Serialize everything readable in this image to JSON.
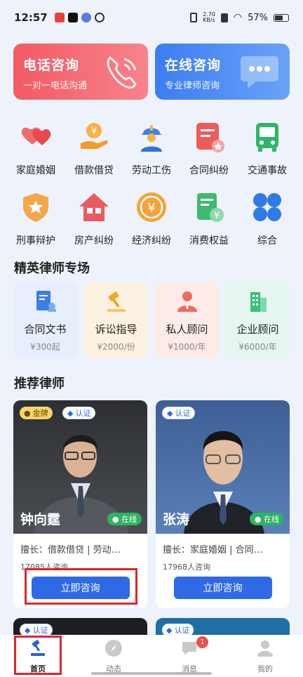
{
  "status_bar": {
    "time": "12:57",
    "net_speed_top": "2.70",
    "net_speed_bottom": "KB/s",
    "battery": "57%"
  },
  "banners": [
    {
      "title": "电话咨询",
      "subtitle": "一对一电话沟通",
      "color": "#f25a64"
    },
    {
      "title": "在线咨询",
      "subtitle": "专业律师咨询",
      "color": "#3b7df2"
    }
  ],
  "categories": [
    {
      "label": "家庭婚姻",
      "icon": "hearts-icon"
    },
    {
      "label": "借款借贷",
      "icon": "coin-hand-icon"
    },
    {
      "label": "劳动工伤",
      "icon": "worker-helmet-icon"
    },
    {
      "label": "合同纠纷",
      "icon": "contract-icon"
    },
    {
      "label": "交通事故",
      "icon": "bus-icon"
    },
    {
      "label": "刑事辩护",
      "icon": "shield-icon"
    },
    {
      "label": "房产纠纷",
      "icon": "house-icon"
    },
    {
      "label": "经济纠纷",
      "icon": "yen-coin-icon"
    },
    {
      "label": "消费权益",
      "icon": "receipt-icon"
    },
    {
      "label": "综合",
      "icon": "grid-icon"
    }
  ],
  "elite": {
    "title": "精英律师专场",
    "items": [
      {
        "name": "合同文书",
        "price": "¥300起",
        "bg": "#e7eefc"
      },
      {
        "name": "诉讼指导",
        "price": "¥2000/份",
        "bg": "#fdf2e2"
      },
      {
        "name": "私人顾问",
        "price": "¥1000/年",
        "bg": "#fdebe8"
      },
      {
        "name": "企业顾问",
        "price": "¥6000/年",
        "bg": "#e4f6ef"
      }
    ]
  },
  "recommend": {
    "title": "推荐律师",
    "lawyers": [
      {
        "name": "钟向霆",
        "gold": "金牌",
        "cert": "认证",
        "online": "在线",
        "spec": "擅长：借款借贷 | 劳动…",
        "count": "17085人咨询",
        "button": "立即咨询"
      },
      {
        "name": "张涛",
        "cert": "认证",
        "online": "在线",
        "spec": "擅长：家庭婚姻 | 合同…",
        "count": "17968人咨询",
        "button": "立即咨询"
      }
    ],
    "more_badges": [
      "认证",
      "认证"
    ]
  },
  "nav": [
    {
      "label": "首页",
      "icon": "home-gavel-icon"
    },
    {
      "label": "动态",
      "icon": "compass-icon"
    },
    {
      "label": "消息",
      "icon": "message-icon",
      "badge": "1"
    },
    {
      "label": "我的",
      "icon": "user-icon"
    }
  ]
}
